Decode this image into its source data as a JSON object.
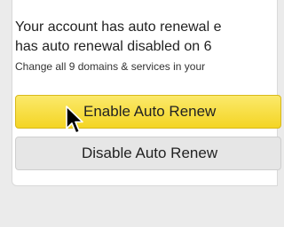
{
  "message": {
    "line1": "Your account has auto renewal e",
    "line2": "has auto renewal disabled on 6",
    "sub": "Change all 9 domains & services in your"
  },
  "buttons": {
    "enable_label": "Enable Auto Renew",
    "disable_label": "Disable Auto Renew"
  },
  "colors": {
    "enable_button": "#f4d524",
    "disable_button": "#e6e6e6",
    "background": "#ebebeb"
  },
  "cursor_icon": "mouse-pointer-icon"
}
